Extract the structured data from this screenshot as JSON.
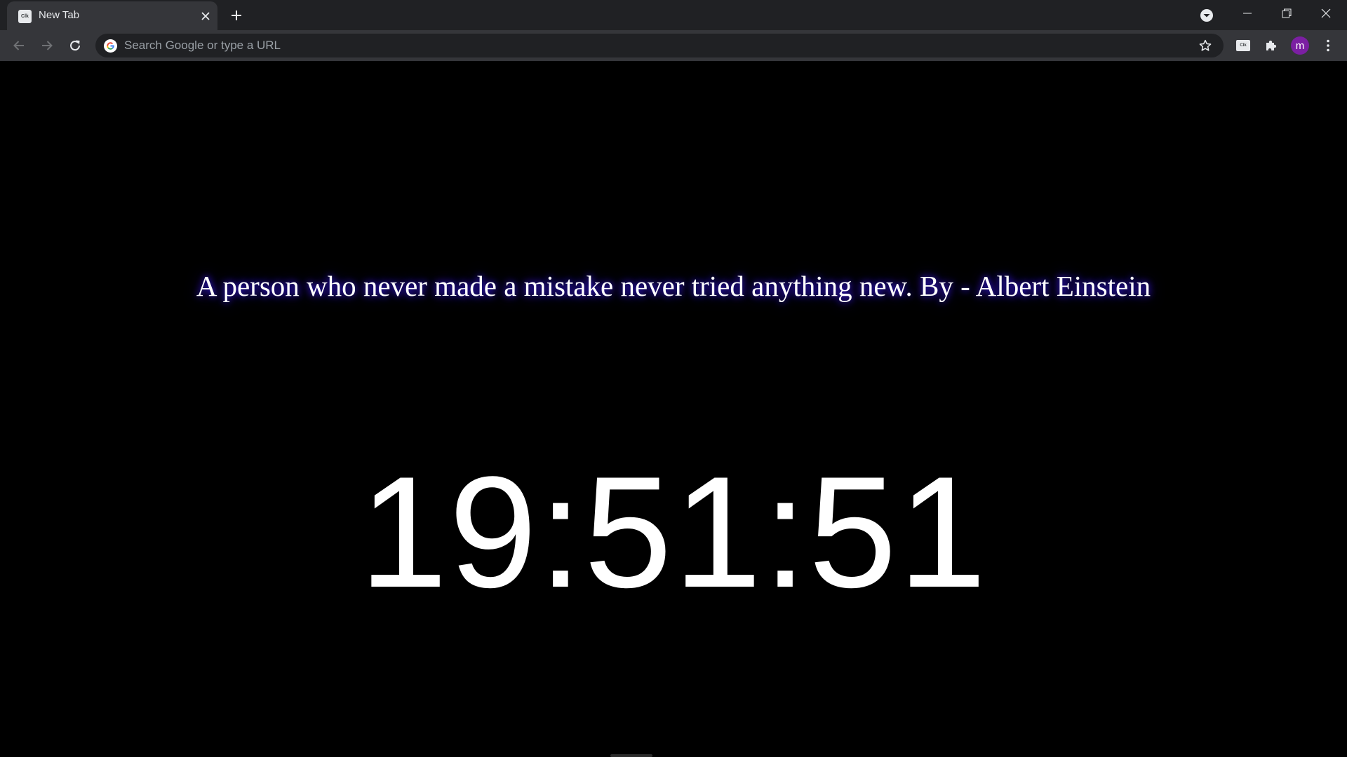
{
  "tab": {
    "title": "New Tab",
    "favicon_text": "Clk"
  },
  "omnibox": {
    "placeholder": "Search Google or type a URL"
  },
  "extension": {
    "thumb_text": "Clk"
  },
  "profile": {
    "initial": "m",
    "color": "#7b1fa2"
  },
  "page": {
    "quote": "A person who never made a mistake never tried anything new. By - Albert Einstein",
    "clock": "19:51:51"
  },
  "icons": {
    "tab_close": "close-icon",
    "new_tab": "plus-icon",
    "tab_search": "chevron-down-circle-icon",
    "minimize": "minimize-icon",
    "restore": "restore-icon",
    "window_close": "close-icon",
    "back": "arrow-left-icon",
    "forward": "arrow-right-icon",
    "reload": "reload-icon",
    "google": "google-icon",
    "bookmark": "star-icon",
    "extensions": "puzzle-icon",
    "menu": "kebab-menu-icon"
  }
}
